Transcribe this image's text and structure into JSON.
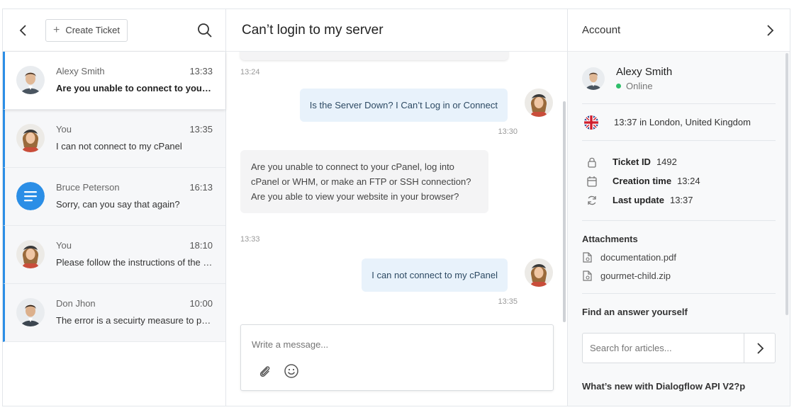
{
  "left": {
    "create_label": "Create Ticket",
    "conversations": [
      {
        "name": "Alexy Smith",
        "time": "13:33",
        "message": "Are you unable to connect to your cPanel, log into cPanel or WHM",
        "avatar": "male-avatar",
        "active": true
      },
      {
        "name": "You",
        "time": "13:35",
        "message": "I can not connect to my cPanel",
        "avatar": "female-avatar"
      },
      {
        "name": "Bruce Peterson",
        "time": "16:13",
        "message": "Sorry, can you say that again?",
        "avatar": "bot-avatar"
      },
      {
        "name": "You",
        "time": "18:10",
        "message": "Please follow the instructions of the article",
        "avatar": "female-avatar"
      },
      {
        "name": "Don Jhon",
        "time": "10:00",
        "message": "The error is a secuirty measure to protect",
        "avatar": "male-avatar"
      }
    ]
  },
  "center": {
    "title": "Can’t login to my server",
    "messages": [
      {
        "ts": "13:24"
      },
      {
        "text": "Is the Server Down? I Can’t Log in or Connect",
        "ts": "13:30"
      },
      {
        "text": "Are you unable to connect to your cPanel, log into cPanel or WHM, or make an FTP or SSH connection? Are you able to view your website in your browser?",
        "ts": "13:33"
      },
      {
        "text": "I can not connect to my cPanel",
        "ts": "13:35"
      }
    ],
    "composer_placeholder": "Write a message..."
  },
  "right": {
    "title": "Account",
    "user": {
      "name": "Alexy Smith",
      "status": "Online"
    },
    "location": "13:37 in London, United Kingdom",
    "info": [
      {
        "label": "Ticket ID",
        "value": "1492",
        "icon": "lock-icon"
      },
      {
        "label": "Creation time",
        "value": "13:24",
        "icon": "calendar-icon"
      },
      {
        "label": "Last update",
        "value": "13:37",
        "icon": "refresh-icon"
      }
    ],
    "attachments_title": "Attachments",
    "attachments": [
      "documentation.pdf",
      "gourmet-child.zip"
    ],
    "find_title": "Find an answer yourself",
    "search_placeholder": "Search for articles...",
    "article": "What’s new with Dialogflow API V2?p"
  },
  "colors": {
    "accent": "#2b8ee6",
    "online": "#2fbe6a",
    "bubble_out": "#e8f2fb",
    "bubble_in": "#f4f4f5"
  }
}
